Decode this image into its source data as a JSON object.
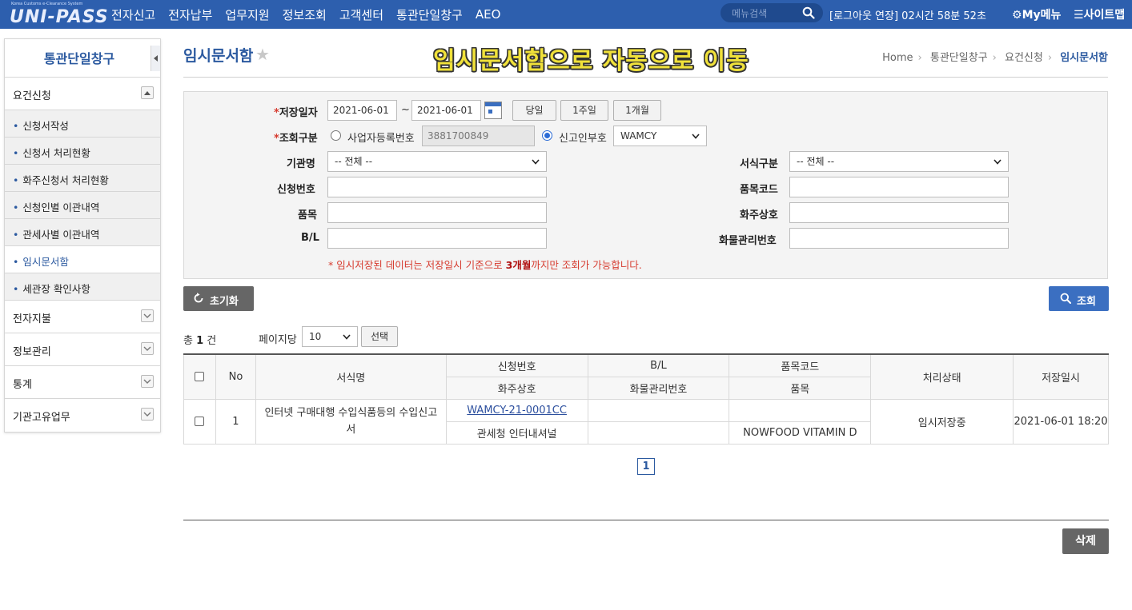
{
  "brand": {
    "tagline": "Korea Customs e-Clearance System",
    "logo_text": "UNI-PASS"
  },
  "nav": [
    "전자신고",
    "전자납부",
    "업무지원",
    "정보조회",
    "고객센터",
    "통관단일창구",
    "AEO"
  ],
  "header": {
    "search_placeholder": "메뉴검색",
    "logout_text": "[로그아웃 연장] 02시간 58분 52초",
    "mymenu": "My메뉴",
    "sitemap": "사이트맵"
  },
  "sidebar": {
    "title": "통관단일창구",
    "group_active": "요건신청",
    "sub_items": [
      "신청서작성",
      "신청서 처리현황",
      "화주신청서 처리현황",
      "신청인별 이관내역",
      "관세사별 이관내역",
      "임시문서함",
      "세관장 확인사항"
    ],
    "groups": [
      "전자지불",
      "정보관리",
      "통계",
      "기관고유업무"
    ]
  },
  "page": {
    "title": "임시문서함",
    "annotation": "임시문서함으로 자동으로 이동",
    "breadcrumb": [
      "Home",
      "통관단일창구",
      "요건신청",
      "임시문서함"
    ]
  },
  "form": {
    "save_date_label": "저장일자",
    "date_from": "2021-06-01",
    "tilde": "~",
    "date_to": "2021-06-01",
    "btn_today": "당일",
    "btn_week": "1주일",
    "btn_month": "1개월",
    "query_type_label": "조회구분",
    "radio_bizno": "사업자등록번호",
    "bizno_value": "3881700849",
    "radio_applicant": "신고인부호",
    "applicant_value": "WAMCY",
    "agency_label": "기관명",
    "agency_value": "-- 전체 --",
    "form_type_label": "서식구분",
    "form_type_value": "-- 전체 --",
    "appno_label": "신청번호",
    "itemcode_label": "품목코드",
    "item_label": "품목",
    "owner_label": "화주상호",
    "bl_label": "B/L",
    "cargo_label": "화물관리번호",
    "notice_prefix": "* 임시저장된 데이터는 저장일시 기준으로 ",
    "notice_bold": "3개월",
    "notice_suffix": "까지만 조회가 가능합니다."
  },
  "actions": {
    "reset": "초기화",
    "search": "조회",
    "delete": "삭제"
  },
  "list": {
    "total_prefix": "총 ",
    "total_count": "1",
    "total_suffix": " 건",
    "perpage_label": "페이지당",
    "perpage_value": "10",
    "select_btn": "선택"
  },
  "table": {
    "headers": {
      "no": "No",
      "form_name": "서식명",
      "app_no": "신청번호",
      "bl": "B/L",
      "item_code": "품목코드",
      "status": "처리상태",
      "saved_at": "저장일시",
      "owner": "화주상호",
      "cargo_no": "화물관리번호",
      "item": "품목"
    },
    "rows": [
      {
        "no": "1",
        "form_name": "인터넷 구매대행 수입식품등의 수입신고서",
        "app_no": "WAMCY-21-0001CC",
        "bl": "",
        "item_code": "",
        "status": "임시저장중",
        "saved_at": "2021-06-01 18:20",
        "owner": "관세청 인터내셔널",
        "cargo_no": "",
        "item": "NOWFOOD VITAMIN D"
      }
    ]
  },
  "pagination": {
    "current": "1"
  }
}
